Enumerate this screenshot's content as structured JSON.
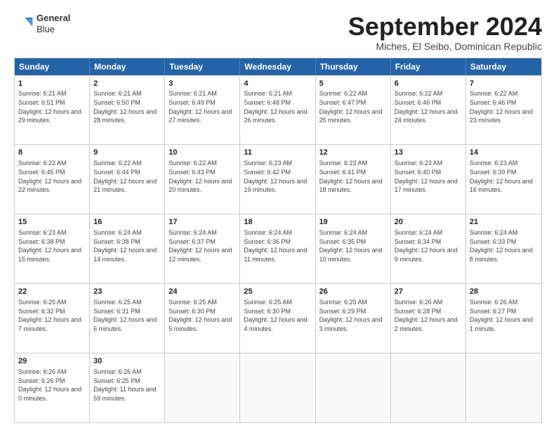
{
  "logo": {
    "line1": "General",
    "line2": "Blue"
  },
  "title": "September 2024",
  "subtitle": "Miches, El Seibo, Dominican Republic",
  "header": {
    "days": [
      "Sunday",
      "Monday",
      "Tuesday",
      "Wednesday",
      "Thursday",
      "Friday",
      "Saturday"
    ]
  },
  "rows": [
    [
      {
        "day": "",
        "sunrise": "",
        "sunset": "",
        "daylight": ""
      },
      {
        "day": "2",
        "sunrise": "Sunrise: 6:21 AM",
        "sunset": "Sunset: 6:50 PM",
        "daylight": "Daylight: 12 hours and 28 minutes."
      },
      {
        "day": "3",
        "sunrise": "Sunrise: 6:21 AM",
        "sunset": "Sunset: 6:49 PM",
        "daylight": "Daylight: 12 hours and 27 minutes."
      },
      {
        "day": "4",
        "sunrise": "Sunrise: 6:21 AM",
        "sunset": "Sunset: 6:48 PM",
        "daylight": "Daylight: 12 hours and 26 minutes."
      },
      {
        "day": "5",
        "sunrise": "Sunrise: 6:22 AM",
        "sunset": "Sunset: 6:47 PM",
        "daylight": "Daylight: 12 hours and 25 minutes."
      },
      {
        "day": "6",
        "sunrise": "Sunrise: 6:22 AM",
        "sunset": "Sunset: 6:46 PM",
        "daylight": "Daylight: 12 hours and 24 minutes."
      },
      {
        "day": "7",
        "sunrise": "Sunrise: 6:22 AM",
        "sunset": "Sunset: 6:46 PM",
        "daylight": "Daylight: 12 hours and 23 minutes."
      }
    ],
    [
      {
        "day": "8",
        "sunrise": "Sunrise: 6:22 AM",
        "sunset": "Sunset: 6:45 PM",
        "daylight": "Daylight: 12 hours and 22 minutes."
      },
      {
        "day": "9",
        "sunrise": "Sunrise: 6:22 AM",
        "sunset": "Sunset: 6:44 PM",
        "daylight": "Daylight: 12 hours and 21 minutes."
      },
      {
        "day": "10",
        "sunrise": "Sunrise: 6:22 AM",
        "sunset": "Sunset: 6:43 PM",
        "daylight": "Daylight: 12 hours and 20 minutes."
      },
      {
        "day": "11",
        "sunrise": "Sunrise: 6:23 AM",
        "sunset": "Sunset: 6:42 PM",
        "daylight": "Daylight: 12 hours and 19 minutes."
      },
      {
        "day": "12",
        "sunrise": "Sunrise: 6:23 AM",
        "sunset": "Sunset: 6:41 PM",
        "daylight": "Daylight: 12 hours and 18 minutes."
      },
      {
        "day": "13",
        "sunrise": "Sunrise: 6:23 AM",
        "sunset": "Sunset: 6:40 PM",
        "daylight": "Daylight: 12 hours and 17 minutes."
      },
      {
        "day": "14",
        "sunrise": "Sunrise: 6:23 AM",
        "sunset": "Sunset: 6:39 PM",
        "daylight": "Daylight: 12 hours and 16 minutes."
      }
    ],
    [
      {
        "day": "15",
        "sunrise": "Sunrise: 6:23 AM",
        "sunset": "Sunset: 6:38 PM",
        "daylight": "Daylight: 12 hours and 15 minutes."
      },
      {
        "day": "16",
        "sunrise": "Sunrise: 6:24 AM",
        "sunset": "Sunset: 6:38 PM",
        "daylight": "Daylight: 12 hours and 14 minutes."
      },
      {
        "day": "17",
        "sunrise": "Sunrise: 6:24 AM",
        "sunset": "Sunset: 6:37 PM",
        "daylight": "Daylight: 12 hours and 12 minutes."
      },
      {
        "day": "18",
        "sunrise": "Sunrise: 6:24 AM",
        "sunset": "Sunset: 6:36 PM",
        "daylight": "Daylight: 12 hours and 11 minutes."
      },
      {
        "day": "19",
        "sunrise": "Sunrise: 6:24 AM",
        "sunset": "Sunset: 6:35 PM",
        "daylight": "Daylight: 12 hours and 10 minutes."
      },
      {
        "day": "20",
        "sunrise": "Sunrise: 6:24 AM",
        "sunset": "Sunset: 6:34 PM",
        "daylight": "Daylight: 12 hours and 9 minutes."
      },
      {
        "day": "21",
        "sunrise": "Sunrise: 6:24 AM",
        "sunset": "Sunset: 6:33 PM",
        "daylight": "Daylight: 12 hours and 8 minutes."
      }
    ],
    [
      {
        "day": "22",
        "sunrise": "Sunrise: 6:25 AM",
        "sunset": "Sunset: 6:32 PM",
        "daylight": "Daylight: 12 hours and 7 minutes."
      },
      {
        "day": "23",
        "sunrise": "Sunrise: 6:25 AM",
        "sunset": "Sunset: 6:31 PM",
        "daylight": "Daylight: 12 hours and 6 minutes."
      },
      {
        "day": "24",
        "sunrise": "Sunrise: 6:25 AM",
        "sunset": "Sunset: 6:30 PM",
        "daylight": "Daylight: 12 hours and 5 minutes."
      },
      {
        "day": "25",
        "sunrise": "Sunrise: 6:25 AM",
        "sunset": "Sunset: 6:30 PM",
        "daylight": "Daylight: 12 hours and 4 minutes."
      },
      {
        "day": "26",
        "sunrise": "Sunrise: 6:25 AM",
        "sunset": "Sunset: 6:29 PM",
        "daylight": "Daylight: 12 hours and 3 minutes."
      },
      {
        "day": "27",
        "sunrise": "Sunrise: 6:26 AM",
        "sunset": "Sunset: 6:28 PM",
        "daylight": "Daylight: 12 hours and 2 minutes."
      },
      {
        "day": "28",
        "sunrise": "Sunrise: 6:26 AM",
        "sunset": "Sunset: 6:27 PM",
        "daylight": "Daylight: 12 hours and 1 minute."
      }
    ],
    [
      {
        "day": "29",
        "sunrise": "Sunrise: 6:26 AM",
        "sunset": "Sunset: 6:26 PM",
        "daylight": "Daylight: 12 hours and 0 minutes."
      },
      {
        "day": "30",
        "sunrise": "Sunrise: 6:26 AM",
        "sunset": "Sunset: 6:25 PM",
        "daylight": "Daylight: 11 hours and 59 minutes."
      },
      {
        "day": "",
        "sunrise": "",
        "sunset": "",
        "daylight": ""
      },
      {
        "day": "",
        "sunrise": "",
        "sunset": "",
        "daylight": ""
      },
      {
        "day": "",
        "sunrise": "",
        "sunset": "",
        "daylight": ""
      },
      {
        "day": "",
        "sunrise": "",
        "sunset": "",
        "daylight": ""
      },
      {
        "day": "",
        "sunrise": "",
        "sunset": "",
        "daylight": ""
      }
    ]
  ],
  "row0_first": {
    "day": "1",
    "sunrise": "Sunrise: 6:21 AM",
    "sunset": "Sunset: 6:51 PM",
    "daylight": "Daylight: 12 hours and 29 minutes."
  }
}
